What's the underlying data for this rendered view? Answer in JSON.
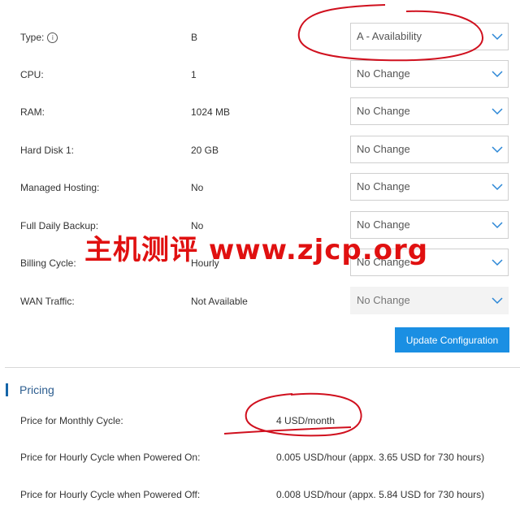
{
  "config_rows": [
    {
      "label": "Type:",
      "value": "B",
      "select": "A - Availability",
      "has_info": true,
      "disabled": false
    },
    {
      "label": "CPU:",
      "value": "1",
      "select": "No Change",
      "disabled": false
    },
    {
      "label": "RAM:",
      "value": "1024 MB",
      "select": "No Change",
      "disabled": false
    },
    {
      "label": "Hard Disk 1:",
      "value": "20 GB",
      "select": "No Change",
      "disabled": false
    },
    {
      "label": "Managed Hosting:",
      "value": "No",
      "select": "No Change",
      "disabled": false
    },
    {
      "label": "Full Daily Backup:",
      "value": "No",
      "select": "No Change",
      "disabled": false
    },
    {
      "label": "Billing Cycle:",
      "value": "Hourly",
      "select": "No Change",
      "disabled": false
    },
    {
      "label": "WAN Traffic:",
      "value": "Not Available",
      "select": "No Change",
      "disabled": true
    }
  ],
  "update_button": "Update Configuration",
  "pricing": {
    "title": "Pricing",
    "rows": [
      {
        "label": "Price for Monthly Cycle:",
        "value": "4 USD/month"
      },
      {
        "label": "Price for Hourly Cycle when Powered On:",
        "value": "0.005 USD/hour (appx. 3.65 USD for 730 hours)"
      },
      {
        "label": "Price for Hourly Cycle when Powered Off:",
        "value": "0.008 USD/hour (appx. 5.84 USD for 730 hours)"
      }
    ]
  },
  "watermark": "主机测评 www.zjcp.org",
  "colors": {
    "accent": "#1a8fe3",
    "section_title": "#2c5d8f",
    "annotation": "#d0101e",
    "watermark": "#e01010"
  },
  "icons": {
    "info": "info-icon",
    "dropdown": "chevron-down-icon"
  }
}
